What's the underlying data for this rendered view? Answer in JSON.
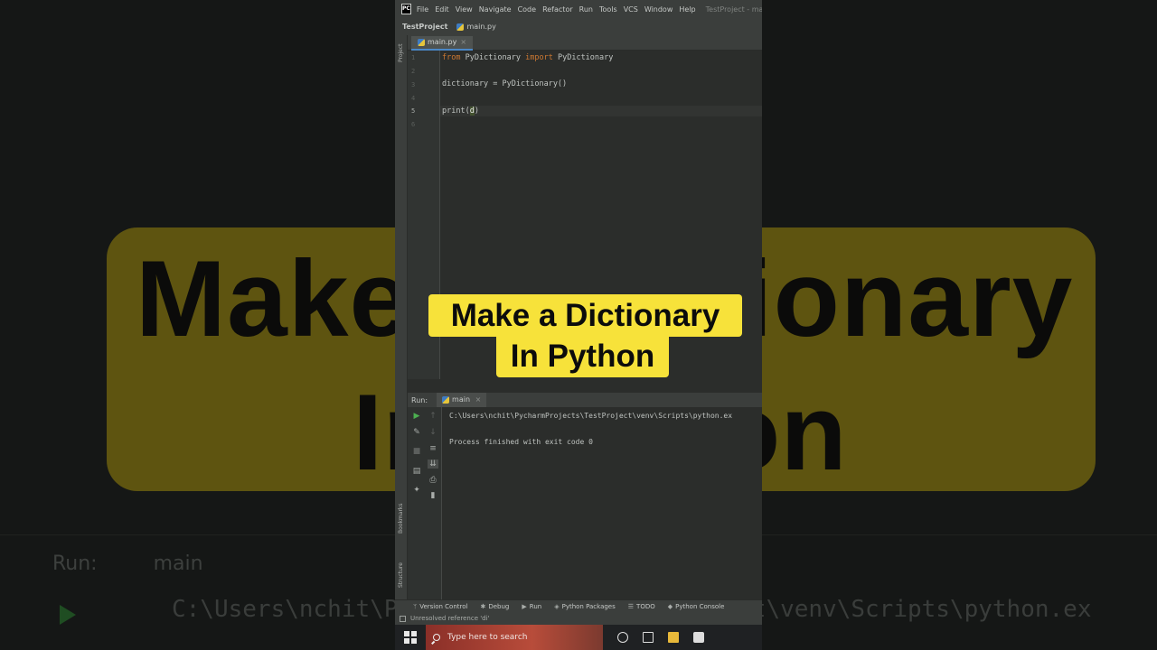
{
  "menubar": {
    "app_logo": "PC",
    "items": [
      "File",
      "Edit",
      "View",
      "Navigate",
      "Code",
      "Refactor",
      "Run",
      "Tools",
      "VCS",
      "Window",
      "Help"
    ],
    "window_title": "TestProject - ma"
  },
  "navbar": {
    "project": "TestProject",
    "file": "main.py"
  },
  "left_strip": {
    "project_label": "Project",
    "bookmarks_label": "Bookmarks",
    "structure_label": "Structure"
  },
  "editor": {
    "tab_label": "main.py",
    "tab_close": "×",
    "line_numbers": [
      "1",
      "2",
      "3",
      "4",
      "5",
      "6"
    ],
    "line1": {
      "kw1": "from",
      "mod": " PyDictionary ",
      "kw2": "import",
      "name": " PyDictionary"
    },
    "line3": "dictionary = PyDictionary()",
    "line5": {
      "before": "print(",
      "selected": "d",
      "after": ")"
    }
  },
  "run_window": {
    "label": "Run:",
    "tab": "main",
    "tab_close": "×",
    "output_path": "C:\\Users\\nchit\\PycharmProjects\\TestProject\\venv\\Scripts\\python.ex",
    "output_exit": "Process finished with exit code 0"
  },
  "bottom_tools": [
    "Version Control",
    "Debug",
    "Run",
    "Python Packages",
    "TODO",
    "Python Console"
  ],
  "status_text": "Unresolved reference 'di'",
  "taskbar": {
    "search_placeholder": "Type here to search"
  },
  "overlay": {
    "line1": "Make a Dictionary",
    "line2": "In Python"
  },
  "background": {
    "title": "Make a Dictionary",
    "subtitle": "In Python",
    "run_label": "Run:",
    "run_tab": "main",
    "path": "C:\\Users\\nchit\\PycharmProjects\\TestProject\\venv\\Scripts\\python.ex"
  },
  "colors": {
    "keyword": "#cc7832",
    "card": "#f7e23a",
    "ide_bg": "#2b2d2b",
    "tab_underline": "#4a88c7",
    "run_green": "#4caf50"
  }
}
